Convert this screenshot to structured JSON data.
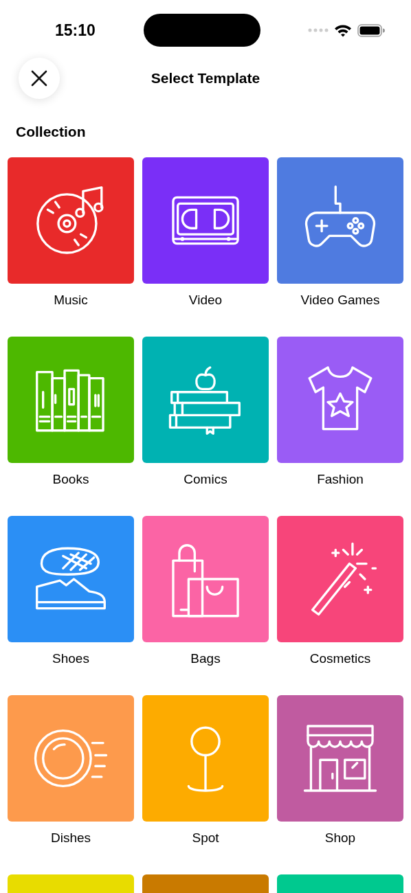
{
  "status_bar": {
    "time": "15:10"
  },
  "header": {
    "title": "Select Template"
  },
  "section": {
    "title": "Collection"
  },
  "templates": [
    {
      "label": "Music",
      "color": "#e82a2a"
    },
    {
      "label": "Video",
      "color": "#7a2ff7"
    },
    {
      "label": "Video Games",
      "color": "#4f7be0"
    },
    {
      "label": "Books",
      "color": "#4db800"
    },
    {
      "label": "Comics",
      "color": "#00b2b2"
    },
    {
      "label": "Fashion",
      "color": "#9a5cf5"
    },
    {
      "label": "Shoes",
      "color": "#2b8ff5"
    },
    {
      "label": "Bags",
      "color": "#fb64a5"
    },
    {
      "label": "Cosmetics",
      "color": "#f7457a"
    },
    {
      "label": "Dishes",
      "color": "#fd9a4c"
    },
    {
      "label": "Spot",
      "color": "#fdab00"
    },
    {
      "label": "Shop",
      "color": "#c05ba0"
    },
    {
      "color": "#e8dc00"
    },
    {
      "color": "#c97a00"
    },
    {
      "color": "#00c98f"
    }
  ]
}
